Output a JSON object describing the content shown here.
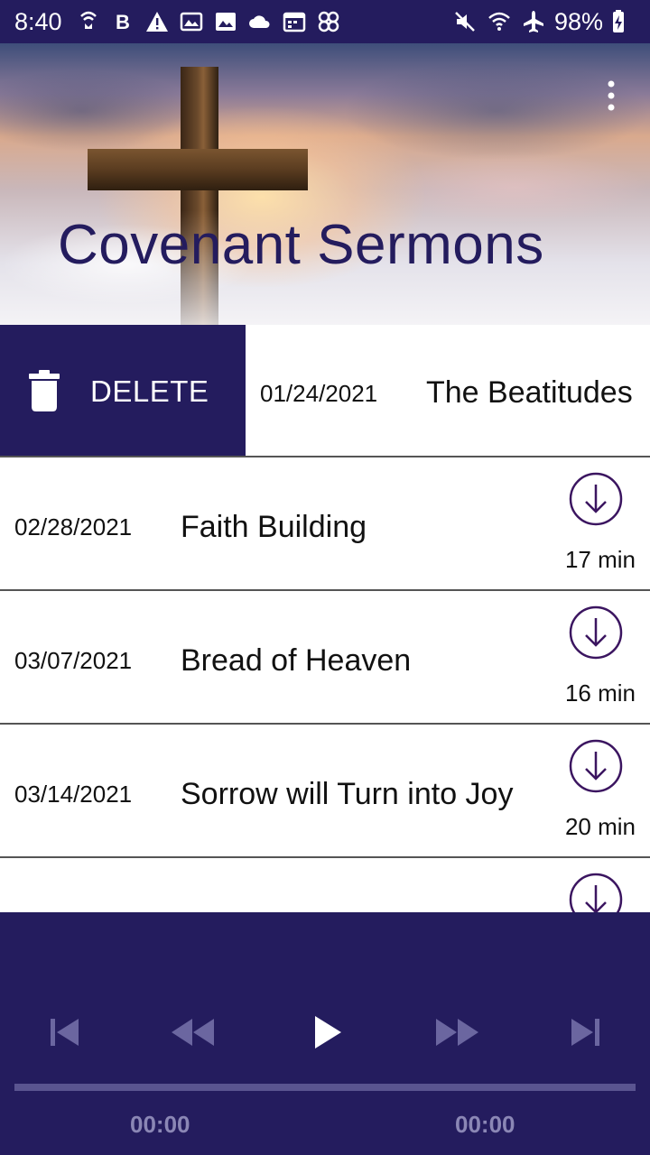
{
  "status_bar": {
    "time": "8:40",
    "battery": "98%",
    "left_icons": [
      "wifi-calling-icon",
      "bold-b-icon",
      "warning-icon",
      "gallery-icon",
      "image-icon",
      "cloud-icon",
      "calendar-icon",
      "pinwheel-icon"
    ],
    "right_icons": [
      "mute-icon",
      "wifi-icon",
      "airplane-icon",
      "battery-charging-icon"
    ]
  },
  "header": {
    "title": "Covenant Sermons",
    "menu_icon": "overflow-menu-icon"
  },
  "swiped_item": {
    "action_label": "DELETE",
    "action_icon": "trash-icon",
    "date": "01/24/2021",
    "title": "The Beatitudes"
  },
  "sermons": [
    {
      "date": "02/28/2021",
      "title": "Faith Building",
      "duration": "17 min"
    },
    {
      "date": "03/07/2021",
      "title": "Bread of Heaven",
      "duration": "16 min"
    },
    {
      "date": "03/14/2021",
      "title": "Sorrow will Turn into Joy",
      "duration": "20 min"
    },
    {
      "date": "",
      "title": "",
      "duration": ""
    }
  ],
  "player": {
    "controls": [
      "skip-previous-icon",
      "rewind-icon",
      "play-icon",
      "fast-forward-icon",
      "skip-next-icon"
    ],
    "current_time": "00:00",
    "total_time": "00:00",
    "progress": 0
  },
  "colors": {
    "primary": "#241c5e",
    "download_icon": "#3b1560",
    "disabled_control": "#6b66a0"
  }
}
